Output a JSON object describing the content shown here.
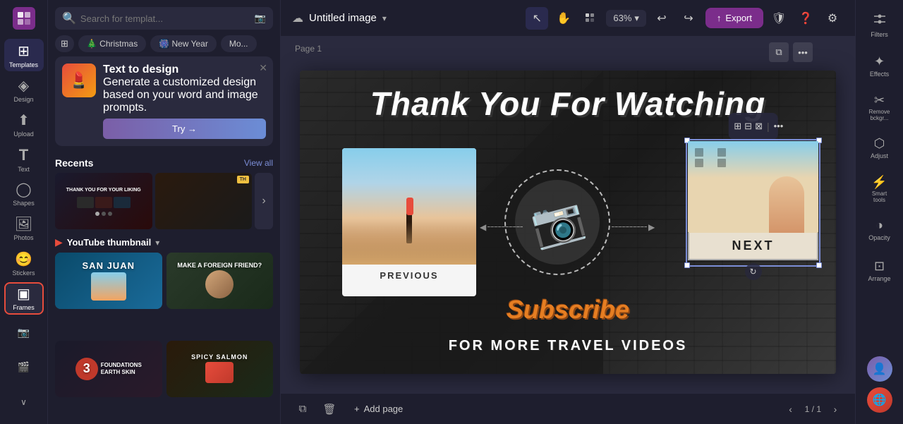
{
  "app": {
    "logo": "✦",
    "title": "Untitled image",
    "title_chevron": "▾"
  },
  "toolbar": {
    "search_placeholder": "Search for templat...",
    "filter_icon": "⊞",
    "zoom": "63%",
    "zoom_chevron": "▾",
    "undo_label": "↩",
    "redo_label": "↪",
    "export_label": "Export",
    "export_icon": "↑",
    "cloud_icon": "☁",
    "cursor_tool": "↖",
    "hand_tool": "✋",
    "grid_tool": "⊞",
    "shield_icon": "🛡",
    "help_icon": "?",
    "settings_icon": "⚙"
  },
  "sidebar": {
    "items": [
      {
        "id": "templates",
        "label": "Templates",
        "icon": "⊞",
        "active": true
      },
      {
        "id": "design",
        "label": "Design",
        "icon": "◈"
      },
      {
        "id": "upload",
        "label": "Upload",
        "icon": "↑"
      },
      {
        "id": "text",
        "label": "Text",
        "icon": "T"
      },
      {
        "id": "shapes",
        "label": "Shapes",
        "icon": "◯"
      },
      {
        "id": "photos",
        "label": "Photos",
        "icon": "🖼"
      },
      {
        "id": "stickers",
        "label": "Stickers",
        "icon": "😊"
      },
      {
        "id": "frames",
        "label": "Frames",
        "icon": "▣",
        "highlighted": true
      },
      {
        "id": "more1",
        "label": "•••",
        "icon": "⋯"
      },
      {
        "id": "more2",
        "label": "⋮",
        "icon": "⋮"
      }
    ]
  },
  "panel": {
    "search_placeholder": "Search for templat...",
    "tags": [
      "🎄 Christmas",
      "🎆 New Year",
      "Mo..."
    ],
    "promo": {
      "title": "Text to design",
      "description": "Generate a customized design based on your word and image prompts.",
      "button_label": "Try →"
    },
    "recents": {
      "title": "Recents",
      "view_all": "View all"
    },
    "section": {
      "icon": "▶",
      "title": "YouTube thumbnail",
      "chevron": "▾"
    },
    "thumbnails": [
      {
        "id": "sj",
        "label": "SAN JUAN"
      },
      {
        "id": "fgf",
        "label": "MAKE A FOREIGN FRIEND?"
      },
      {
        "id": "dark1",
        "label": ""
      },
      {
        "id": "dark2",
        "label": "SPICY SALMON"
      }
    ]
  },
  "canvas": {
    "page_label": "Page 1",
    "title": "Thank You For Watching",
    "previous_label": "PREVIOUS",
    "next_label": "NEXT",
    "subscribe_line1": "Subscribe",
    "subscribe_line2": "FOR MORE TRAVEL VIDEOS"
  },
  "bottom_bar": {
    "duplicate_icon": "⧉",
    "trash_icon": "🗑",
    "add_page_label": "Add page",
    "page_current": "1",
    "page_total": "1",
    "page_separator": "/"
  },
  "right_panel": {
    "items": [
      {
        "id": "filters",
        "label": "Filters",
        "icon": "◈"
      },
      {
        "id": "effects",
        "label": "Effects",
        "icon": "✦"
      },
      {
        "id": "remove-bg",
        "label": "Remove\nbckgr...",
        "icon": "✂"
      },
      {
        "id": "adjust",
        "label": "Adjust",
        "icon": "⬡"
      },
      {
        "id": "smart-tools",
        "label": "Smart\ntools",
        "icon": "⚡"
      },
      {
        "id": "opacity",
        "label": "Opacity",
        "icon": "◑"
      },
      {
        "id": "arrange",
        "label": "Arrange",
        "icon": "⊡"
      }
    ]
  },
  "float_toolbar": {
    "btn1": "⊞",
    "btn2": "⊟",
    "btn3": "⊠",
    "btn4": "•••"
  }
}
